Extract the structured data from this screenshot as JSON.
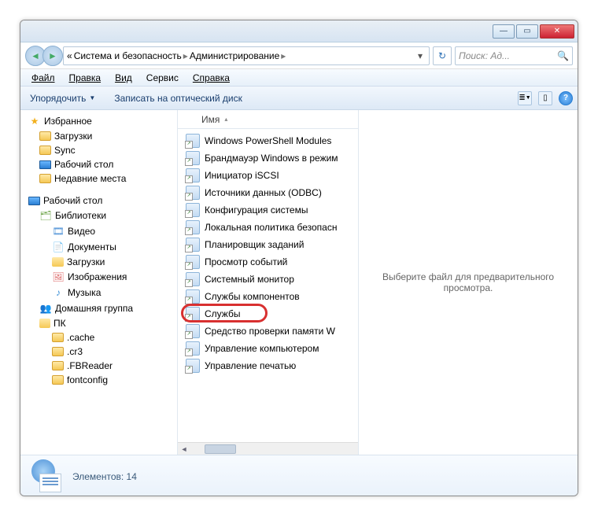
{
  "breadcrumb": {
    "root_icon": "«",
    "seg1": "Система и безопасность",
    "seg2": "Администрирование",
    "sep": "▸"
  },
  "search": {
    "placeholder": "Поиск: Ад..."
  },
  "menubar": {
    "file": "Файл",
    "edit": "Правка",
    "view": "Вид",
    "tools": "Сервис",
    "help": "Справка"
  },
  "toolbar": {
    "organize": "Упорядочить",
    "burn": "Записать на оптический диск"
  },
  "nav": {
    "favorites": "Избранное",
    "downloads": "Загрузки",
    "sync": "Sync",
    "desktop": "Рабочий стол",
    "recent": "Недавние места",
    "desktop2": "Рабочий стол",
    "libraries": "Библиотеки",
    "video": "Видео",
    "documents": "Документы",
    "downloads2": "Загрузки",
    "pictures": "Изображения",
    "music": "Музыка",
    "homegroup": "Домашняя группа",
    "pc": "ПК",
    "cache": ".cache",
    "cr3": ".cr3",
    "fbreader": ".FBReader",
    "fontconfig": "fontconfig"
  },
  "column": {
    "name": "Имя"
  },
  "files": [
    "Windows PowerShell Modules",
    "Брандмауэр Windows в режим",
    "Инициатор iSCSI",
    "Источники данных (ODBC)",
    "Конфигурация системы",
    "Локальная политика безопасн",
    "Планировщик заданий",
    "Просмотр событий",
    "Системный монитор",
    "Службы компонентов",
    "Службы",
    "Средство проверки памяти W",
    "Управление компьютером",
    "Управление печатью"
  ],
  "highlighted_index": 10,
  "preview": {
    "text": "Выберите файл для предварительного просмотра."
  },
  "status": {
    "label": "Элементов:",
    "count": "14"
  }
}
